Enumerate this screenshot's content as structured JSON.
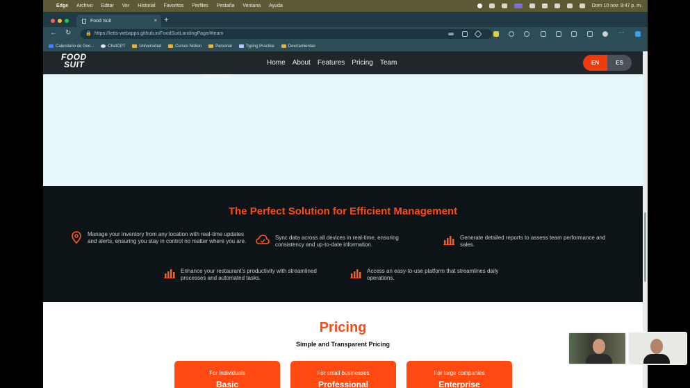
{
  "menubar": {
    "app": "Edge",
    "items": [
      "Archivo",
      "Editar",
      "Ver",
      "Historial",
      "Favoritos",
      "Perfiles",
      "Pestaña",
      "Ventana",
      "Ayuda"
    ],
    "clock": "Dom 10 nov. 9:47 p. m."
  },
  "browser": {
    "tab_title": "Food Suit",
    "url": "https://letts-webapps.github.io/FoodSuitLandingPage/#team",
    "bookmarks": [
      "Calendario de Goo...",
      "ChatGPT",
      "Universidad",
      "Cursos Notion",
      "Personal",
      "Typing Practice",
      "Devrramientas"
    ]
  },
  "site": {
    "logo_line1": "FOOD",
    "logo_line2": "SUIT",
    "nav": [
      "Home",
      "About",
      "Features",
      "Pricing",
      "Team"
    ],
    "lang_en": "EN",
    "lang_es": "ES"
  },
  "solution": {
    "title": "The Perfect Solution for Efficient Management",
    "features": [
      {
        "icon": "location-pin-icon",
        "text": "Manage your inventory from any location with real-time updates and alerts, ensuring you stay in control no matter where you are."
      },
      {
        "icon": "cloud-sync-icon",
        "text": "Sync data across all devices in real-time, ensuring consistency and up-to-date information."
      },
      {
        "icon": "bar-chart-icon",
        "text": "Generate detailed reports to assess team performance and sales."
      },
      {
        "icon": "bar-chart-icon",
        "text": "Enhance your restaurant's productivity with streamlined processes and automated tasks."
      },
      {
        "icon": "bar-chart-icon",
        "text": "Access an easy-to-use platform that streamlines daily operations."
      }
    ]
  },
  "pricing": {
    "title": "Pricing",
    "subtitle": "Simple and Transparent Pricing",
    "plans": [
      {
        "audience": "For individuals",
        "name": "Basic"
      },
      {
        "audience": "For small businesses",
        "name": "Professional"
      },
      {
        "audience": "For large companies",
        "name": "Enterprise"
      }
    ]
  },
  "colors": {
    "accent": "#ff4a12",
    "dark_section": "#0c1418",
    "page_bg": "#e6f7fb",
    "nav_bg": "#20272b"
  }
}
